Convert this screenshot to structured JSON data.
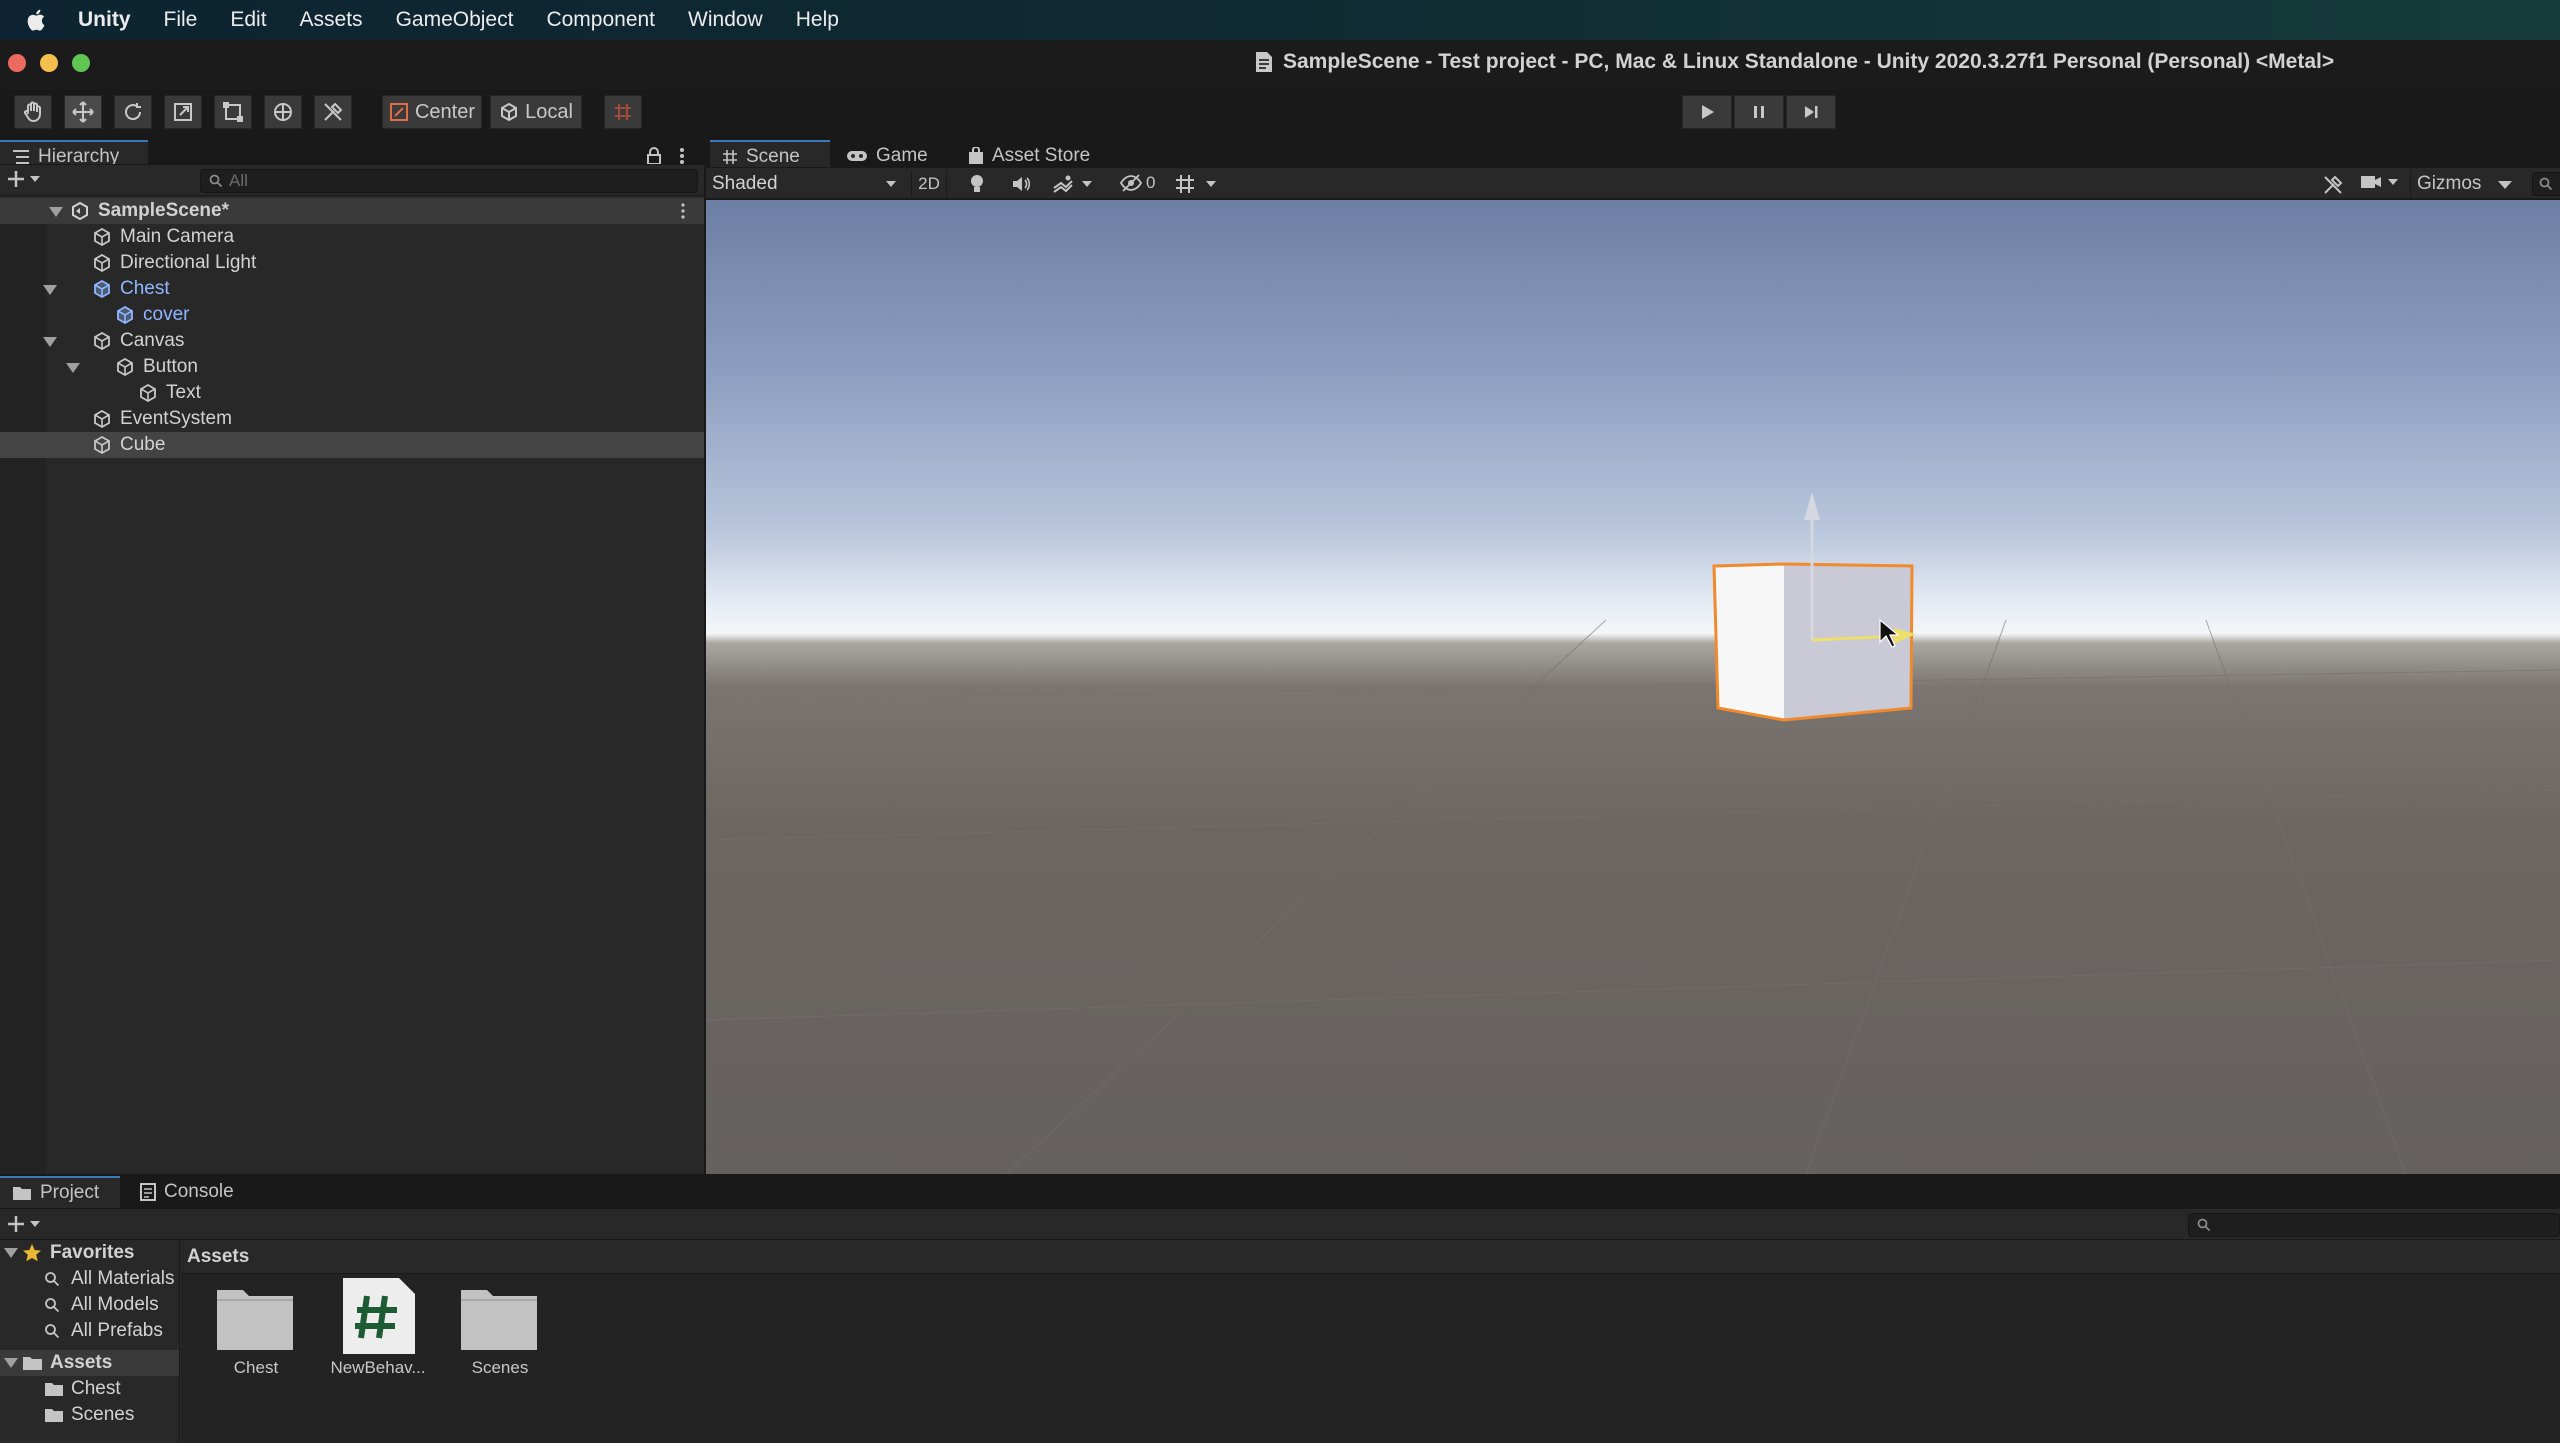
{
  "menubar": {
    "app": "Unity",
    "items": [
      "File",
      "Edit",
      "Assets",
      "GameObject",
      "Component",
      "Window",
      "Help"
    ]
  },
  "window": {
    "title": "SampleScene - Test project - PC, Mac & Linux Standalone - Unity 2020.3.27f1 Personal (Personal) <Metal>"
  },
  "toolbar": {
    "center_label": "Center",
    "local_label": "Local"
  },
  "hierarchy": {
    "tab": "Hierarchy",
    "search_placeholder": "All",
    "scene": "SampleScene*",
    "items": [
      {
        "label": "Main Camera",
        "depth": 1,
        "prefab": false,
        "expandable": false
      },
      {
        "label": "Directional Light",
        "depth": 1,
        "prefab": false,
        "expandable": false
      },
      {
        "label": "Chest",
        "depth": 1,
        "prefab": true,
        "expandable": true
      },
      {
        "label": "cover",
        "depth": 2,
        "prefab": true,
        "expandable": false
      },
      {
        "label": "Canvas",
        "depth": 1,
        "prefab": false,
        "expandable": true
      },
      {
        "label": "Button",
        "depth": 2,
        "prefab": false,
        "expandable": true
      },
      {
        "label": "Text",
        "depth": 3,
        "prefab": false,
        "expandable": false
      },
      {
        "label": "EventSystem",
        "depth": 1,
        "prefab": false,
        "expandable": false
      },
      {
        "label": "Cube",
        "depth": 1,
        "prefab": false,
        "expandable": false,
        "selected": true
      }
    ]
  },
  "scene_tabs": {
    "scene": "Scene",
    "game": "Game",
    "asset_store": "Asset Store"
  },
  "scene_bar": {
    "shading": "Shaded",
    "mode_2d": "2D",
    "hidden_count": "0",
    "gizmos": "Gizmos"
  },
  "bottom_tabs": {
    "project": "Project",
    "console": "Console"
  },
  "project": {
    "favorites_label": "Favorites",
    "favorites": [
      "All Materials",
      "All Models",
      "All Prefabs"
    ],
    "assets_label": "Assets",
    "asset_folders": [
      "Chest",
      "Scenes"
    ],
    "breadcrumb": "Assets",
    "grid": [
      {
        "label": "Chest",
        "kind": "folder"
      },
      {
        "label": "NewBehav...",
        "kind": "script"
      },
      {
        "label": "Scenes",
        "kind": "folder"
      }
    ]
  },
  "colors": {
    "accent": "#3a79bb",
    "selection_outline": "#f08a2c",
    "prefab_text": "#8fb6ff"
  }
}
